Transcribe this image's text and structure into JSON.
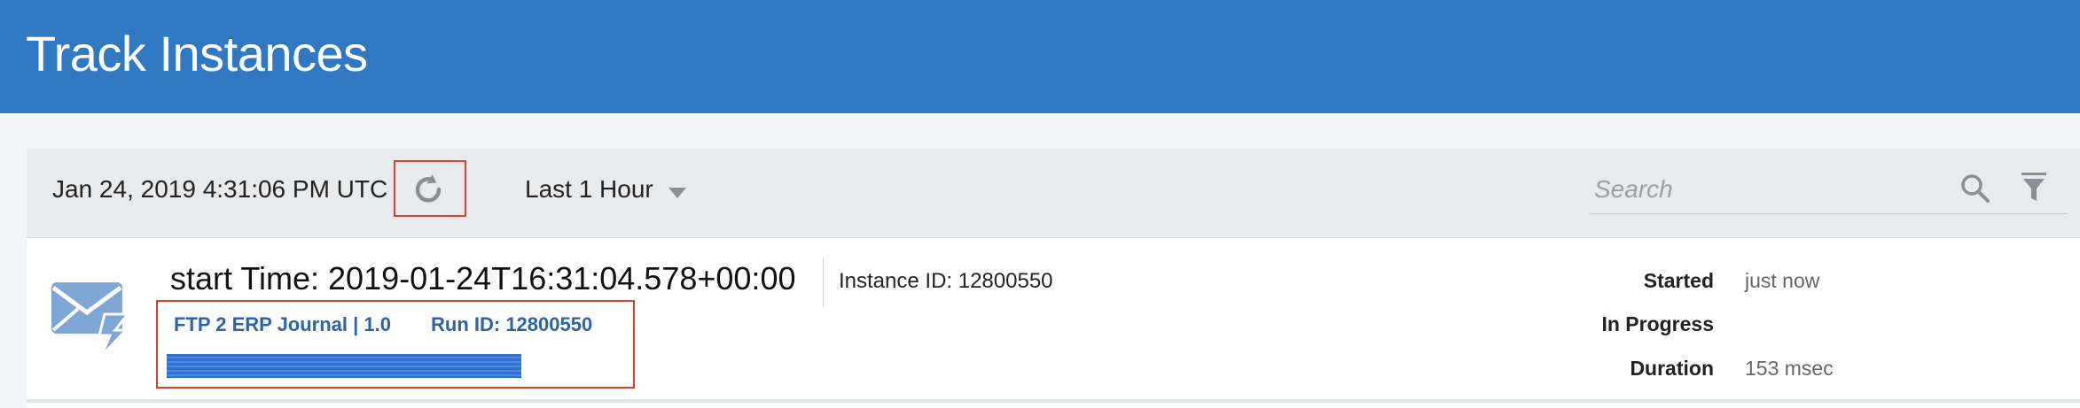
{
  "header": {
    "title": "Track Instances"
  },
  "toolbar": {
    "timestamp": "Jan 24, 2019 4:31:06 PM UTC",
    "time_range": "Last 1 Hour",
    "search_placeholder": "Search"
  },
  "instance": {
    "start_time": "start Time: 2019-01-24T16:31:04.578+00:00",
    "instance_id": "Instance ID: 12800550",
    "flow": "FTP 2 ERP Journal | 1.0",
    "run_id": "Run ID: 12800550",
    "started_label": "Started",
    "started_value": "just now",
    "status_label": "In Progress",
    "duration_label": "Duration",
    "duration_value": "153 msec"
  },
  "icons": {
    "refresh": "refresh-icon",
    "dropdown": "chevron-down-icon",
    "search": "search-icon",
    "filter": "filter-icon",
    "message": "envelope-lightning-icon"
  },
  "colors": {
    "header": "#3079c2",
    "highlight": "#d9432c",
    "link": "#2d64a8",
    "icon": "#7ea7d6"
  }
}
